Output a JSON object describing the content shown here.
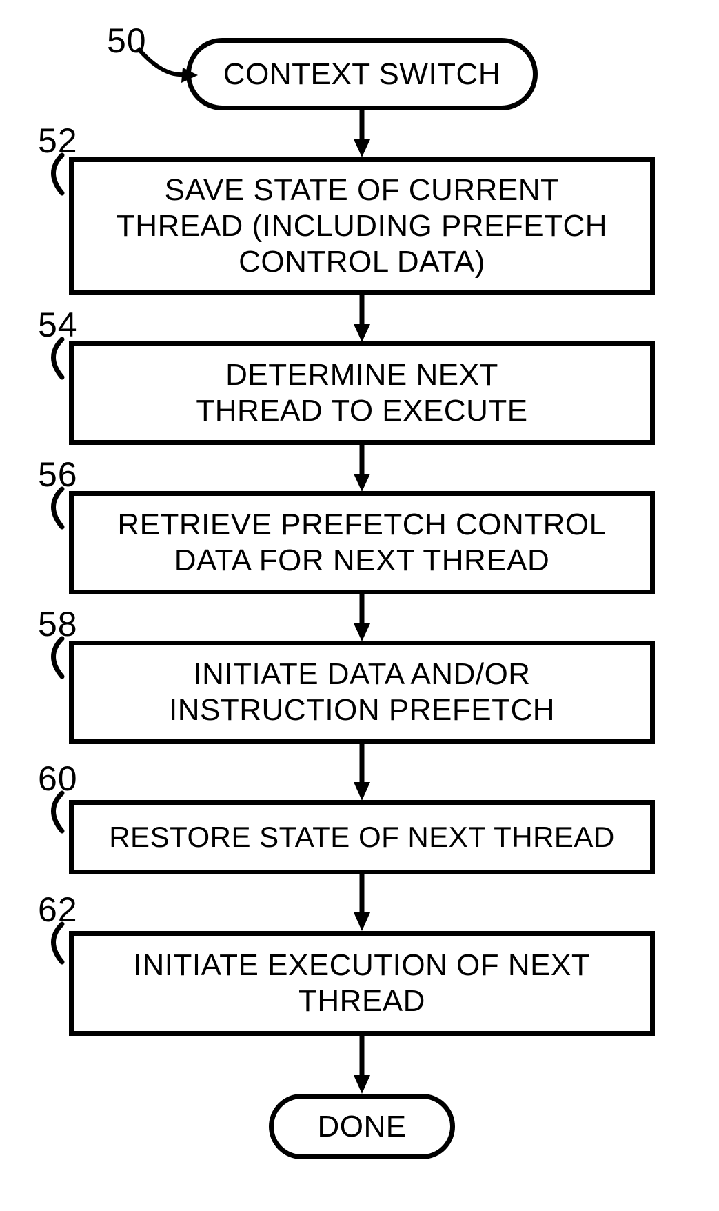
{
  "terminators": {
    "start": {
      "text": "CONTEXT SWITCH",
      "ref": "50"
    },
    "end": {
      "text": "DONE"
    }
  },
  "steps": [
    {
      "ref": "52",
      "text": "SAVE STATE OF CURRENT\nTHREAD (INCLUDING PREFETCH\nCONTROL DATA)"
    },
    {
      "ref": "54",
      "text": "DETERMINE NEXT\nTHREAD TO EXECUTE"
    },
    {
      "ref": "56",
      "text": "RETRIEVE PREFETCH CONTROL\nDATA FOR NEXT THREAD"
    },
    {
      "ref": "58",
      "text": "INITIATE DATA AND/OR\nINSTRUCTION PREFETCH"
    },
    {
      "ref": "60",
      "text": "RESTORE STATE OF NEXT THREAD"
    },
    {
      "ref": "62",
      "text": "INITIATE EXECUTION OF NEXT\nTHREAD"
    }
  ]
}
